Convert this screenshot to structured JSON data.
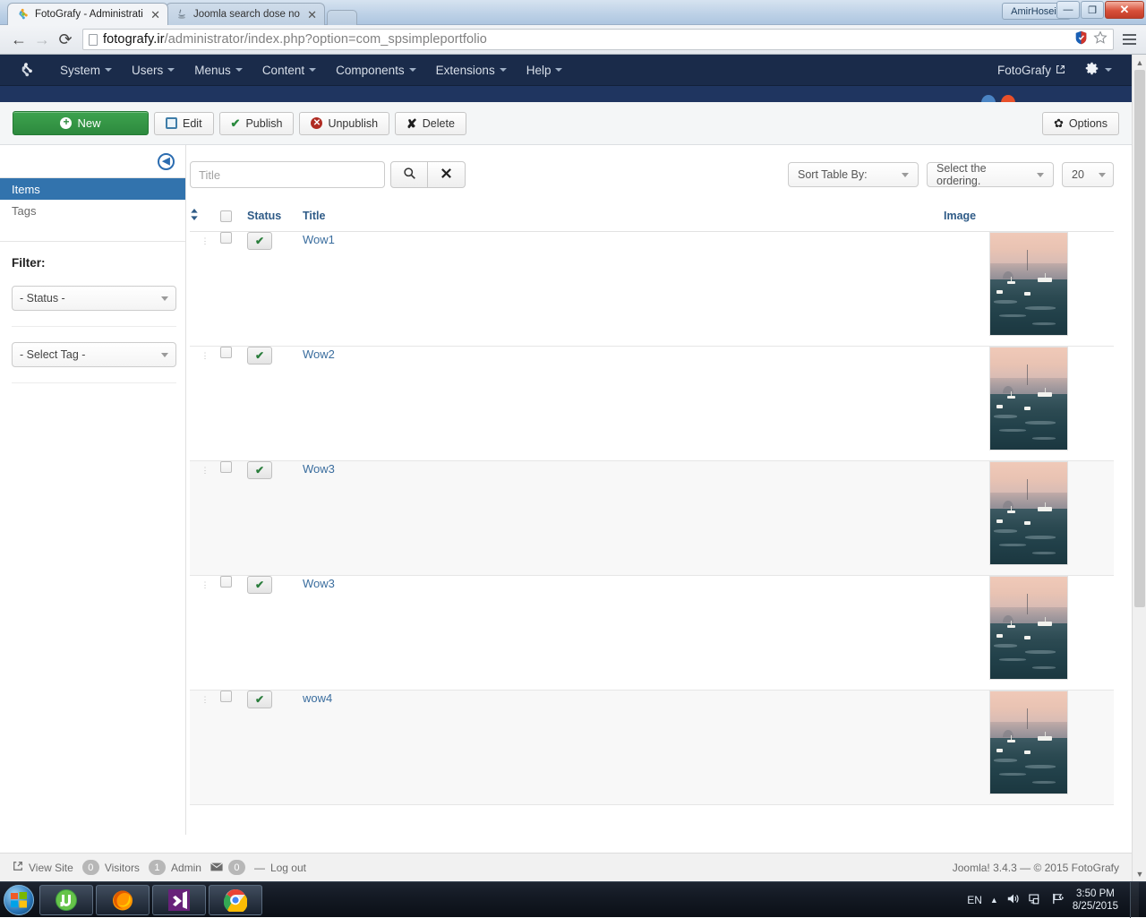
{
  "browser": {
    "tabs": [
      {
        "title": "FotoGrafy - Administration",
        "favicon": "joomla-icon",
        "active": true
      },
      {
        "title": "Joomla search dose not fin",
        "favicon": "java-icon",
        "active": false
      }
    ],
    "new_tab_label": "",
    "window": {
      "user_button": "AmirHosein",
      "minimize": "—",
      "maximize": "❐",
      "close": "✕"
    },
    "nav": {
      "back": "←",
      "forward": "→",
      "reload": "⟳"
    },
    "address": {
      "host": "fotografy.ir",
      "path": "/administrator/index.php?option=com_spsimpleportfolio",
      "full": "fotografy.ir/administrator/index.php?option=com_spsimpleportfolio"
    }
  },
  "admin_menu": {
    "brand": "joomla-logo",
    "items": [
      {
        "label": "System"
      },
      {
        "label": "Users"
      },
      {
        "label": "Menus"
      },
      {
        "label": "Content"
      },
      {
        "label": "Components"
      },
      {
        "label": "Extensions"
      },
      {
        "label": "Help"
      }
    ],
    "site_name": "FotoGrafy",
    "gear": "gear-icon"
  },
  "toolbar": {
    "new_label": "New",
    "edit_label": "Edit",
    "publish_label": "Publish",
    "unpublish_label": "Unpublish",
    "delete_label": "Delete",
    "options_label": "Options"
  },
  "sidebar": {
    "collapse_icon": "collapse-left-icon",
    "nav": [
      {
        "label": "Items",
        "active": true
      },
      {
        "label": "Tags",
        "active": false
      }
    ],
    "filter_title": "Filter:",
    "filters": [
      {
        "label": "- Status -"
      },
      {
        "label": "- Select Tag -"
      }
    ]
  },
  "filterbar": {
    "search_placeholder": "Title",
    "search_value": "",
    "search_icon": "search-icon",
    "clear_icon": "clear-icon",
    "sort_label": "Sort Table By:",
    "ordering_label": "Select the ordering.",
    "limit_label": "20"
  },
  "table": {
    "columns": {
      "handle": "",
      "check": "",
      "status": "Status",
      "title": "Title",
      "image": "Image"
    },
    "rows": [
      {
        "title": "Wow1",
        "status": "published",
        "status_icon": "check-icon",
        "image": "harbor-thumbnail"
      },
      {
        "title": "Wow2",
        "status": "published",
        "status_icon": "check-icon",
        "image": "harbor-thumbnail"
      },
      {
        "title": "Wow3",
        "status": "published",
        "status_icon": "check-icon",
        "image": "harbor-thumbnail"
      },
      {
        "title": "Wow3",
        "status": "published",
        "status_icon": "check-icon",
        "image": "harbor-thumbnail"
      },
      {
        "title": "wow4",
        "status": "published",
        "status_icon": "check-icon",
        "image": "harbor-thumbnail"
      }
    ]
  },
  "footer": {
    "view_site": "View Site",
    "visitors_count": "0",
    "visitors_label": "Visitors",
    "admin_count": "1",
    "admin_label": "Admin",
    "messages_count": "0",
    "separator": "—",
    "logout": "Log out",
    "copyright": "Joomla! 3.4.3  —  © 2015 FotoGrafy"
  },
  "taskbar": {
    "start": "windows-start-orb",
    "items": [
      {
        "name": "utorrent-icon"
      },
      {
        "name": "firefox-icon"
      },
      {
        "name": "visual-studio-icon"
      },
      {
        "name": "chrome-icon"
      }
    ],
    "tray": {
      "language": "EN",
      "show_hidden": "▲",
      "volume": "volume-icon",
      "network": "network-icon",
      "action_center": "flag-icon",
      "time": "3:50 PM",
      "date": "8/25/2015"
    }
  }
}
